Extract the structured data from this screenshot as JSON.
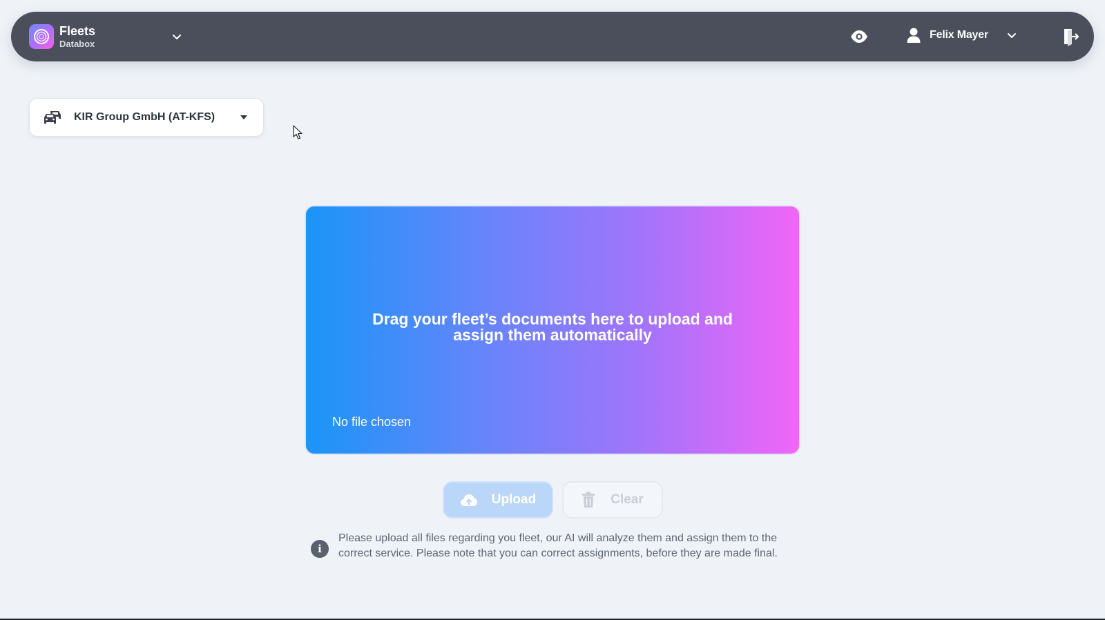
{
  "header": {
    "app_title": "Fleets",
    "app_subtitle": "Databox",
    "user_name": "Felix Mayer"
  },
  "company_selector": {
    "selected": "KIR Group GmbH (AT-KFS)"
  },
  "dropzone": {
    "message": "Drag your fleet’s documents here to upload and assign them automatically",
    "file_status": "No file chosen",
    "gradient_colors": [
      "#1a95f8",
      "#a274fb",
      "#f165f8"
    ]
  },
  "actions": {
    "upload_label": "Upload",
    "clear_label": "Clear"
  },
  "info": {
    "text": "Please upload all files regarding you fleet, our AI will analyze them and assign them to the correct service. Please note that you can correct assignments, before they are made final."
  },
  "colors": {
    "header_bg": "#4a4f5b",
    "page_bg": "#eff3f8"
  }
}
